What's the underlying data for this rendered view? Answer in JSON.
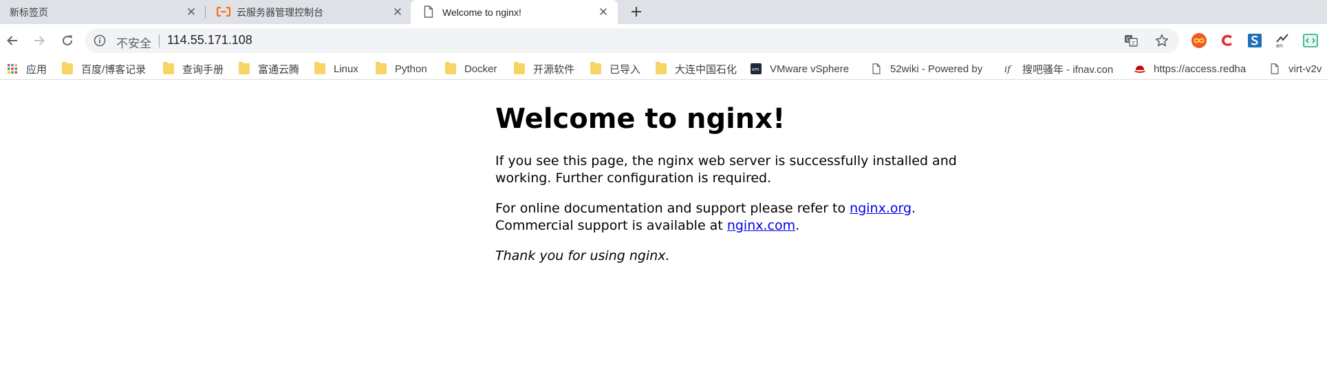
{
  "tabs": [
    {
      "title": "新标签页",
      "active": false,
      "favicon": "none"
    },
    {
      "title": "云服务器管理控制台",
      "active": false,
      "favicon": "aliyun-icon"
    },
    {
      "title": "Welcome to nginx!",
      "active": true,
      "favicon": "page-icon"
    }
  ],
  "toolbar": {
    "security_label": "不安全",
    "url": "114.55.171.108"
  },
  "bookmarks": [
    {
      "label": "应用",
      "icon": "apps-grid-icon"
    },
    {
      "label": "百度/博客记录",
      "icon": "folder-icon"
    },
    {
      "label": "查询手册",
      "icon": "folder-icon"
    },
    {
      "label": "富通云腾",
      "icon": "folder-icon"
    },
    {
      "label": "Linux",
      "icon": "folder-icon"
    },
    {
      "label": "Python",
      "icon": "folder-icon"
    },
    {
      "label": "Docker",
      "icon": "folder-icon"
    },
    {
      "label": "开源软件",
      "icon": "folder-icon"
    },
    {
      "label": "已导入",
      "icon": "folder-icon"
    },
    {
      "label": "大连中国石化",
      "icon": "folder-icon"
    },
    {
      "label": "VMware vSphere",
      "icon": "vmware-icon"
    },
    {
      "label": "52wiki - Powered by",
      "icon": "page-icon"
    },
    {
      "label": "搜吧骚年 - ifnav.con",
      "icon": "ifnav-icon"
    },
    {
      "label": "https://access.redha",
      "icon": "redhat-icon"
    },
    {
      "label": "virt-v2v",
      "icon": "page-icon"
    }
  ],
  "page": {
    "heading": "Welcome to nginx!",
    "para1": "If you see this page, the nginx web server is successfully installed and working. Further configuration is required.",
    "para2_before": "For online documentation and support please refer to ",
    "link1": "nginx.org",
    "para2_middle": ".",
    "para2_line2": "Commercial support is available at ",
    "link2": "nginx.com",
    "para2_end": ".",
    "para3": "Thank you for using nginx."
  },
  "colors": {
    "tabstrip_bg": "#dee1e6",
    "omnibox_bg": "#f1f3f4",
    "link": "#0000ee",
    "aliyun_orange": "#ff6a00",
    "folder_yellow": "#f7d565"
  }
}
